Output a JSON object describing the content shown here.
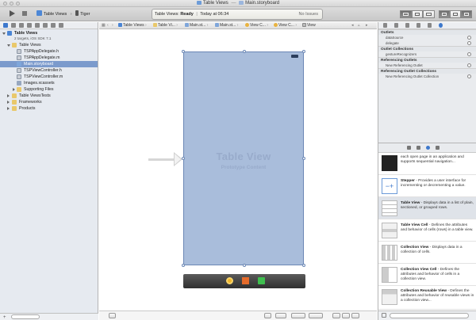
{
  "window": {
    "title": "Table Views",
    "subtitle": "Main.storyboard"
  },
  "toolbar": {
    "scheme": "Table Views",
    "device": "Tiger",
    "status_prefix": "Table Views:",
    "status_state": "Ready",
    "status_time": "Today at 06:34",
    "issues": "No Issues"
  },
  "navigator": {
    "project": "Table Views",
    "project_sub": "2 targets, iOS SDK 7.1",
    "group": "Table Views",
    "files": [
      "TSPAppDelegate.h",
      "TSPAppDelegate.m",
      "Main.storyboard",
      "TSPViewController.h",
      "TSPViewController.m",
      "Images.xcassets"
    ],
    "supporting": "Supporting Files",
    "tests": "Table ViewsTests",
    "frameworks": "Frameworks",
    "products": "Products"
  },
  "jumpbar": {
    "items": [
      "Table Views",
      "Table Vi...",
      "Main.st...",
      "Main.st...",
      "View C...",
      "View C...",
      "View"
    ]
  },
  "canvas": {
    "title": "Table View",
    "subtitle": "Prototype Content"
  },
  "connections": {
    "outlets_header": "Outlets",
    "outlets": [
      "dataSource",
      "delegate"
    ],
    "collections_header": "Outlet Collections",
    "collections": [
      "gestureRecognizers"
    ],
    "ref_header": "Referencing Outlets",
    "ref_item": "New Referencing Outlet",
    "ref_coll_header": "Referencing Outlet Collections",
    "ref_coll_item": "New Referencing Outlet Collection"
  },
  "library": {
    "top_fragment": "each open page in an application and supports sequential navigation...",
    "items": [
      {
        "name": "Stepper",
        "desc": "- Provides a user interface for incrementing or decrementing a value."
      },
      {
        "name": "Table View",
        "desc": "- Displays data in a list of plain, sectioned, or grouped rows."
      },
      {
        "name": "Table View Cell",
        "desc": "- Defines the attributes and behavior of cells (rows) in a table view."
      },
      {
        "name": "Collection View",
        "desc": "- Displays data in a collection of cells."
      },
      {
        "name": "Collection View Cell",
        "desc": "- Defines the attributes and behavior of cells in a collection view."
      },
      {
        "name": "Collection Reusable View",
        "desc": "- Defines the attributes and behavior of reusable views in a collection view..."
      }
    ]
  },
  "colors": {
    "accent": "#3d78cc",
    "selection": "#7b9acc",
    "scene": "#a9bddb"
  }
}
